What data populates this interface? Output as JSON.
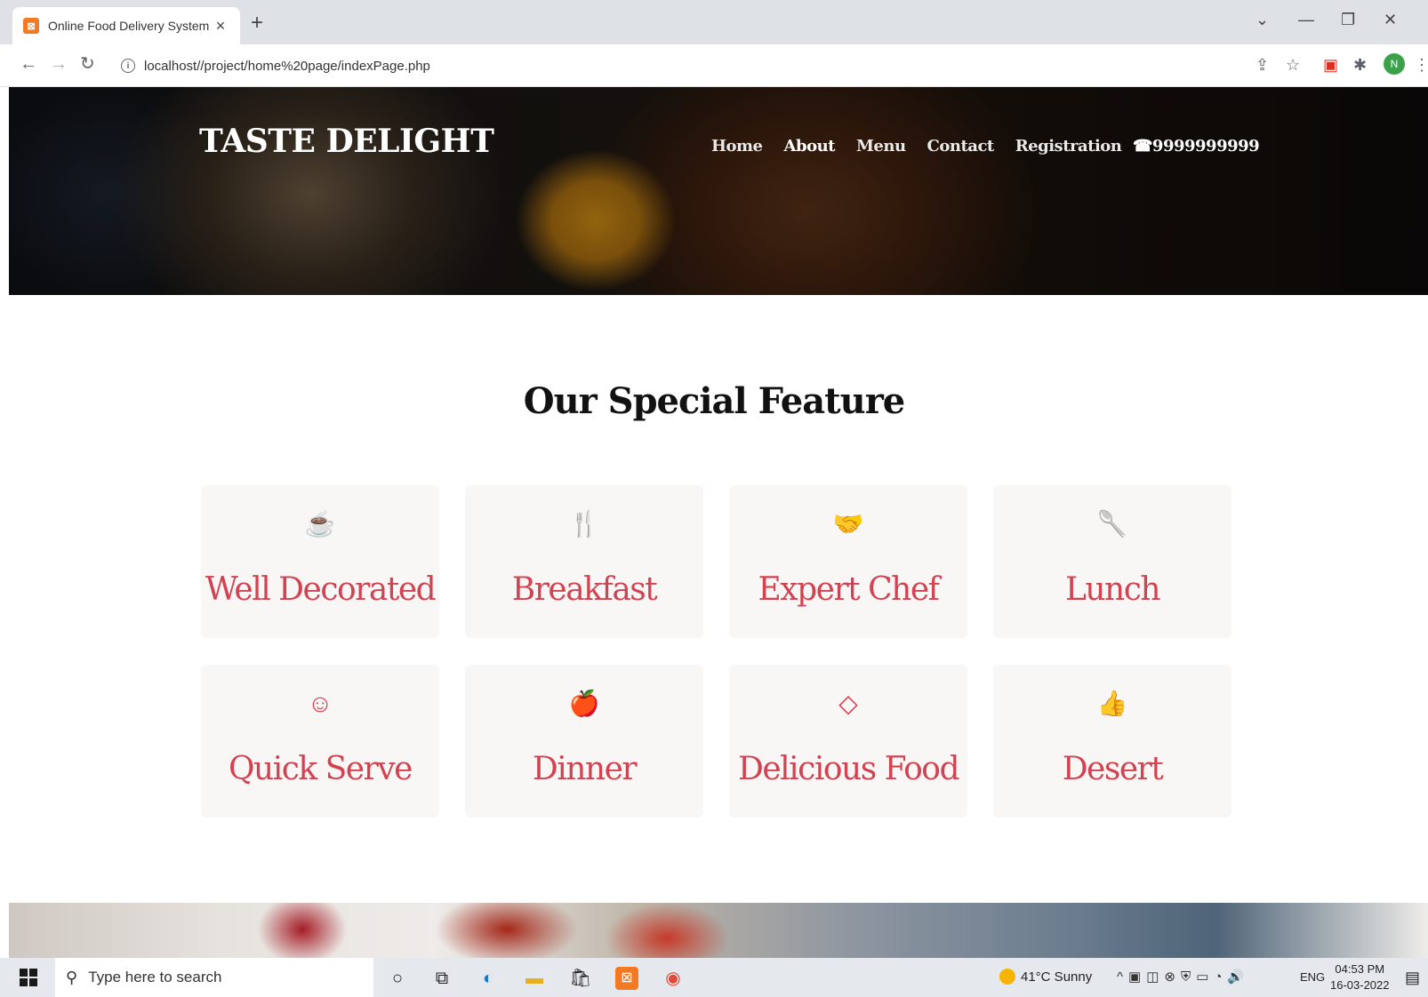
{
  "browser": {
    "tab_title": "Online Food Delivery System",
    "tab_close": "×",
    "new_tab": "+",
    "url": "localhost//project/home%20page/indexPage.php",
    "profile_initial": "N"
  },
  "site": {
    "brand": "TASTE DELIGHT",
    "nav": [
      {
        "label": "Home"
      },
      {
        "label": "About",
        "active": true
      },
      {
        "label": "Menu"
      },
      {
        "label": "Contact"
      },
      {
        "label": "Registration"
      }
    ],
    "phone": "☎9999999999"
  },
  "features": {
    "title": "Our Special Feature",
    "cards": [
      {
        "label": "Well Decorated",
        "icon": "coffee-mug-icon"
      },
      {
        "label": "Breakfast",
        "icon": "cutlery-icon"
      },
      {
        "label": "Expert Chef",
        "icon": "handshake-icon"
      },
      {
        "label": "Lunch",
        "icon": "spoon-icon"
      },
      {
        "label": "Quick Serve",
        "icon": "smile-icon"
      },
      {
        "label": "Dinner",
        "icon": "apple-icon"
      },
      {
        "label": "Delicious Food",
        "icon": "diamond-icon"
      },
      {
        "label": "Desert",
        "icon": "thumbs-up-icon"
      }
    ],
    "accent_color": "#d24352"
  },
  "taskbar": {
    "search_placeholder": "Type here to search",
    "weather": "41°C  Sunny",
    "language": "ENG",
    "time": "04:53 PM",
    "date": "16-03-2022"
  }
}
